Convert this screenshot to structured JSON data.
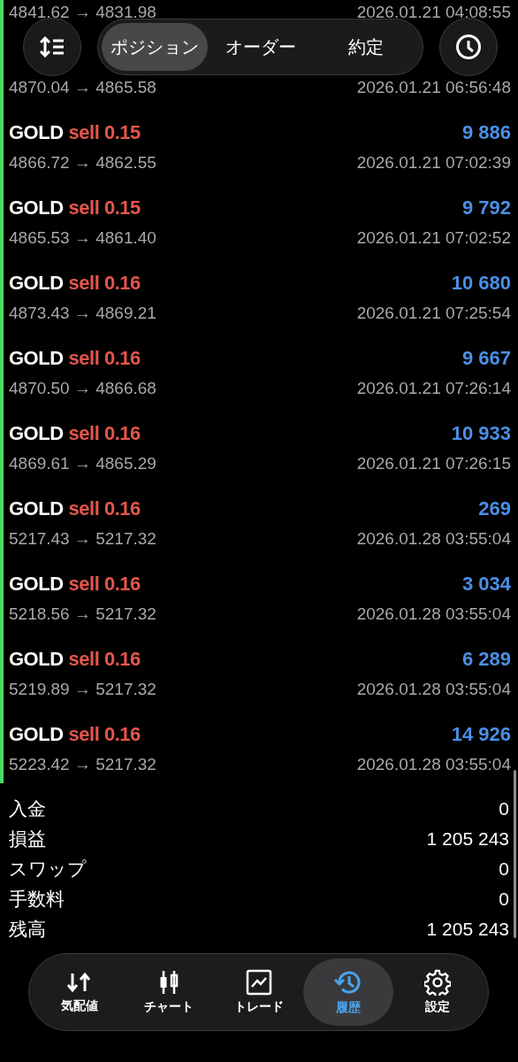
{
  "header": {
    "tabs": [
      {
        "label": "ポジション",
        "selected": true
      },
      {
        "label": "オーダー",
        "selected": false
      },
      {
        "label": "約定",
        "selected": false
      }
    ]
  },
  "deals": [
    {
      "kind": "prices_only",
      "prices": "4841.62 → 4831.98",
      "time": "2026.01.21 04:08:55"
    },
    {
      "kind": "prices_only",
      "prices": "4870.04 → 4865.58",
      "time": "2026.01.21 06:56:48"
    },
    {
      "kind": "full",
      "symbol": "GOLD",
      "side": "sell",
      "volume": "0.15",
      "profit": "9 886",
      "prices": "4866.72 → 4862.55",
      "time": "2026.01.21 07:02:39"
    },
    {
      "kind": "full",
      "symbol": "GOLD",
      "side": "sell",
      "volume": "0.15",
      "profit": "9 792",
      "prices": "4865.53 → 4861.40",
      "time": "2026.01.21 07:02:52"
    },
    {
      "kind": "full",
      "symbol": "GOLD",
      "side": "sell",
      "volume": "0.16",
      "profit": "10 680",
      "prices": "4873.43 → 4869.21",
      "time": "2026.01.21 07:25:54"
    },
    {
      "kind": "full",
      "symbol": "GOLD",
      "side": "sell",
      "volume": "0.16",
      "profit": "9 667",
      "prices": "4870.50 → 4866.68",
      "time": "2026.01.21 07:26:14"
    },
    {
      "kind": "full",
      "symbol": "GOLD",
      "side": "sell",
      "volume": "0.16",
      "profit": "10 933",
      "prices": "4869.61 → 4865.29",
      "time": "2026.01.21 07:26:15"
    },
    {
      "kind": "full",
      "symbol": "GOLD",
      "side": "sell",
      "volume": "0.16",
      "profit": "269",
      "prices": "5217.43 → 5217.32",
      "time": "2026.01.28 03:55:04"
    },
    {
      "kind": "full",
      "symbol": "GOLD",
      "side": "sell",
      "volume": "0.16",
      "profit": "3 034",
      "prices": "5218.56 → 5217.32",
      "time": "2026.01.28 03:55:04"
    },
    {
      "kind": "full",
      "symbol": "GOLD",
      "side": "sell",
      "volume": "0.16",
      "profit": "6 289",
      "prices": "5219.89 → 5217.32",
      "time": "2026.01.28 03:55:04"
    },
    {
      "kind": "full",
      "symbol": "GOLD",
      "side": "sell",
      "volume": "0.16",
      "profit": "14 926",
      "prices": "5223.42 → 5217.32",
      "time": "2026.01.28 03:55:04"
    }
  ],
  "summary": [
    {
      "label": "入金",
      "value": "0"
    },
    {
      "label": "損益",
      "value": "1 205 243"
    },
    {
      "label": "スワップ",
      "value": "0"
    },
    {
      "label": "手数料",
      "value": "0"
    },
    {
      "label": "残高",
      "value": "1 205 243"
    }
  ],
  "nav": [
    {
      "kind": "quotes",
      "label": "気配値",
      "selected": false
    },
    {
      "kind": "chart",
      "label": "チャート",
      "selected": false
    },
    {
      "kind": "trade",
      "label": "トレード",
      "selected": false
    },
    {
      "kind": "history",
      "label": "履歴",
      "selected": true
    },
    {
      "kind": "settings",
      "label": "設定",
      "selected": false
    }
  ]
}
